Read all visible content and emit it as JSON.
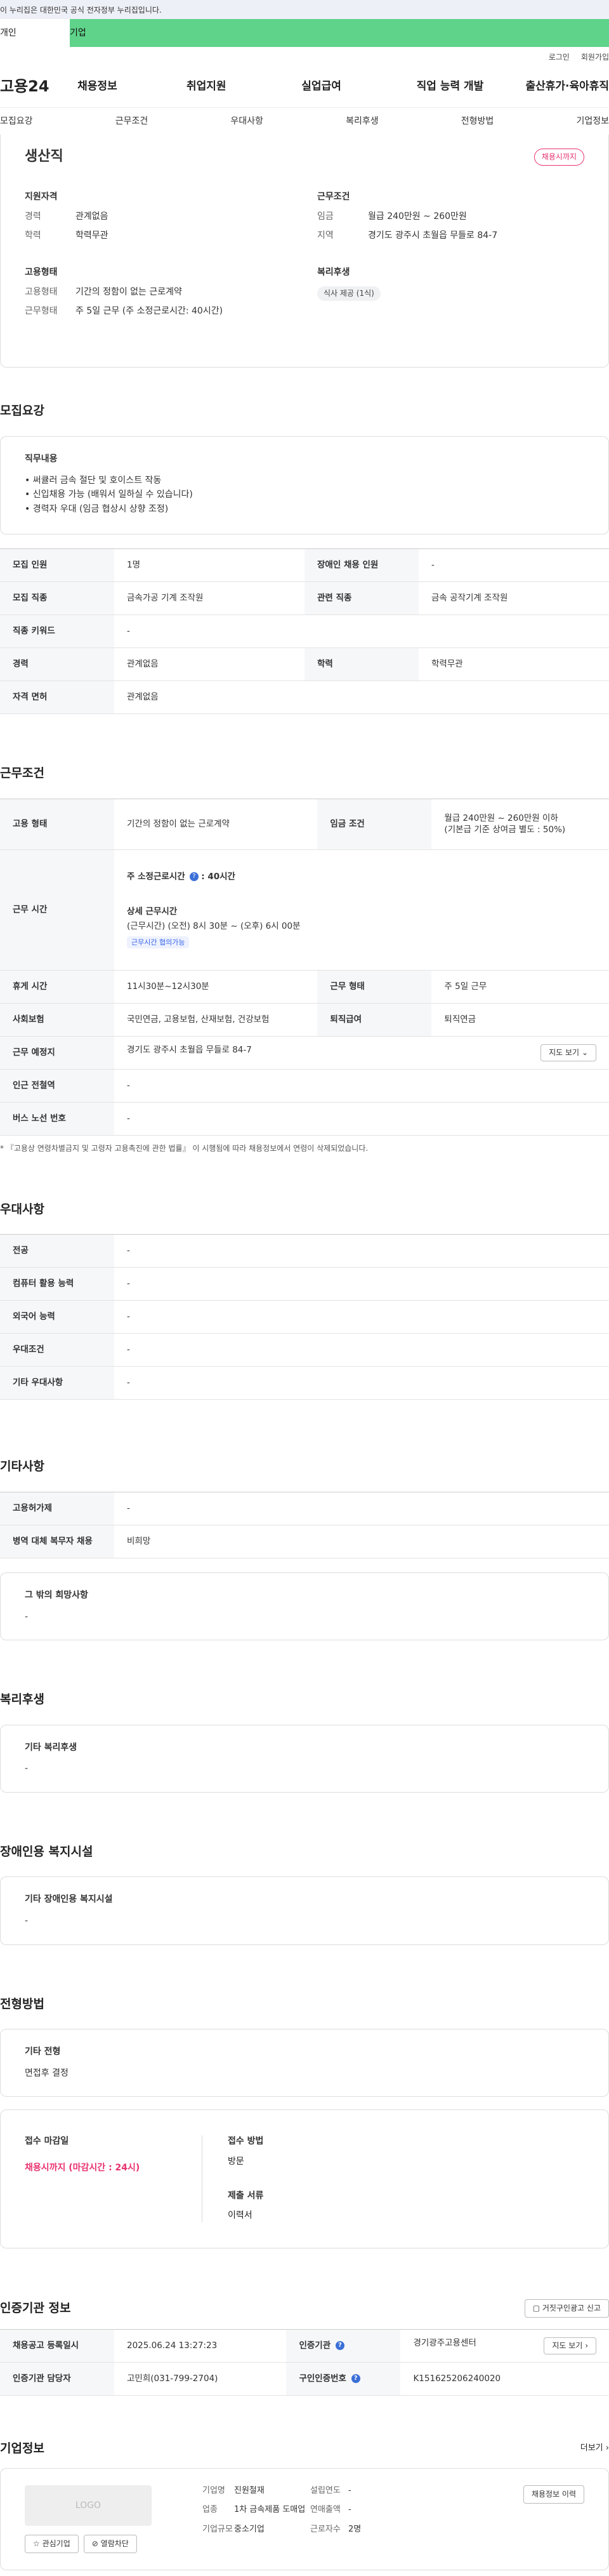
{
  "gov_banner": "이 누리집은 대한민국 공식 전자정부 누리집입니다.",
  "tabs": [
    "개인",
    "기업"
  ],
  "util": [
    "로그인",
    "회원가입"
  ],
  "logo": "고용24",
  "gnb": [
    "채용정보",
    "취업지원",
    "실업급여",
    "직업 능력 개발",
    "출산휴가·육아휴직"
  ],
  "snb": [
    "모집요강",
    "근무조건",
    "우대사항",
    "복리후생",
    "전형방법",
    "기업정보"
  ],
  "summary": {
    "title": "생산직",
    "status": "채용시까지",
    "qual_head": "지원자격",
    "career_k": "경력",
    "career_v": "관계없음",
    "edu_k": "학력",
    "edu_v": "학력무관",
    "cond_head": "근무조건",
    "wage_k": "임금",
    "wage_v": "월급 240만원 ~ 260만원",
    "loc_k": "지역",
    "loc_v": "경기도 광주시 초월읍 무들로 84-7",
    "emp_head": "고용형태",
    "etype_k": "고용형태",
    "etype_v": "기간의 정함이 없는 근로계약",
    "work_k": "근무형태",
    "work_v": "주 5일 근무 (주 소정근로시간: 40시간)",
    "welfare_head": "복리후생",
    "welfare_chip": "식사 제공 (1식)"
  },
  "recruit": {
    "title": "모집요강",
    "duty_head": "직무내용",
    "duty": [
      "• 써큘러 금속 절단 및  호이스트 작동",
      "• 신입채용 가능 (배워서 일하실 수 있습니다)",
      "• 경력자 우대 (임금 협상시 상향 조정)"
    ],
    "rows": [
      [
        "모집 인원",
        "1명",
        "장애인 채용 인원",
        "-"
      ],
      [
        "모집 직종",
        "금속가공 기계 조작원",
        "관련 직종",
        "금속 공작기계 조작원"
      ],
      [
        "직종 키워드",
        "-"
      ],
      [
        "경력",
        "관계없음",
        "학력",
        "학력무관"
      ],
      [
        "자격 면허",
        "관계없음"
      ]
    ]
  },
  "work": {
    "title": "근무조건",
    "etype_k": "고용 형태",
    "etype_v": "기간의 정함이 없는 근로계약",
    "wage_k": "임금 조건",
    "wage_v1": "월급 240만원 ~ 260만원 이하",
    "wage_v2": "(기본급 기준 상여금 별도 : 50%)",
    "hours_k": "근무 시간",
    "hours_week": "주 소정근로시간",
    "hours_week_v": ": 40시간",
    "hours_detail": "상세 근무시간",
    "hours_detail_v": "(근무시간) (오전) 8시 30분 ~ (오후) 6시 00분",
    "hours_chip": "근무시간 협의가능",
    "rest_k": "휴게 시간",
    "rest_v": "11시30분~12시30분",
    "wtype_k": "근무 형태",
    "wtype_v": "주 5일 근무",
    "ins_k": "사회보험",
    "ins_v": "국민연금, 고용보험, 산재보험, 건강보험",
    "ret_k": "퇴직급여",
    "ret_v": "퇴직연금",
    "place_k": "근무 예정지",
    "place_v": "경기도 광주시 초월읍 무들로 84-7",
    "map_btn": "지도 보기",
    "sub_k": "인근 전철역",
    "sub_v": "-",
    "bus_k": "버스 노선 번호",
    "bus_v": "-",
    "note": "* 『고용상 연령차별금지 및 고령자 고용촉진에 관한 법률』 이 시행됨에 따라 채용정보에서 연령이 삭제되었습니다."
  },
  "pref": {
    "title": "우대사항",
    "rows": [
      [
        "전공",
        "-"
      ],
      [
        "컴퓨터 활용 능력",
        "-"
      ],
      [
        "외국어 능력",
        "-"
      ],
      [
        "우대조건",
        "-"
      ],
      [
        "기타 우대사항",
        "-"
      ]
    ]
  },
  "etc": {
    "title": "기타사항",
    "rows": [
      [
        "고용허가제",
        "-"
      ],
      [
        "병역 대체 복무자 채용",
        "비희망"
      ]
    ],
    "other_head": "그 밖의 희망사항",
    "other_v": "-"
  },
  "welfare": {
    "title": "복리후생",
    "head": "기타 복리후생",
    "v": "-"
  },
  "disab": {
    "title": "장애인용 복지시설",
    "head": "기타 장애인용 복지시설",
    "v": "-"
  },
  "select": {
    "title": "전형방법",
    "head": "기타 전형",
    "v": "면접후 결정",
    "deadline_k": "접수 마감일",
    "deadline_v": "채용시까지 (마감시간 : 24시)",
    "method_k": "접수 방법",
    "method_v": "방문",
    "docs_k": "제출 서류",
    "docs_v": "이력서"
  },
  "cert": {
    "title": "인증기관 정보",
    "report_btn": "거짓구인광고 신고",
    "reg_k": "채용공고 등록일시",
    "reg_v": "2025.06.24 13:27:23",
    "org_k": "인증기관",
    "org_v": "경기광주고용센터",
    "map_btn": "지도 보기",
    "mgr_k": "인증기관 담당자",
    "mgr_v": "고민희(031-799-2704)",
    "id_k": "구인인증번호",
    "id_v": "K151625206240020"
  },
  "company": {
    "title": "기업정보",
    "more": "더보기",
    "logo": "LOGO",
    "fav": "관심기업",
    "block": "열람차단",
    "name_k": "기업명",
    "name_v": "진원철재",
    "ind_k": "업종",
    "ind_v": "1차 금속제품 도매업",
    "size_k": "기업규모",
    "size_v": "중소기업",
    "year_k": "설립연도",
    "year_v": "-",
    "sales_k": "연매출액",
    "sales_v": "-",
    "emp_k": "근로자수",
    "emp_v": "2명",
    "jobs_btn": "채용정보 이력"
  }
}
